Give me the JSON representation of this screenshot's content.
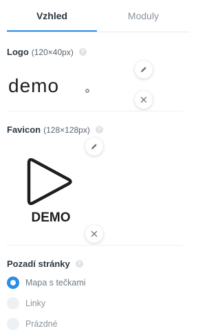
{
  "tabs": [
    {
      "label": "Vzhled",
      "active": true
    },
    {
      "label": "Moduly",
      "active": false
    }
  ],
  "logo": {
    "title": "Logo",
    "size": "(120×40px)",
    "help": "?",
    "image_text": "demo"
  },
  "favicon": {
    "title": "Favicon",
    "size": "(128×128px)",
    "help": "?",
    "image_text": "DEMO"
  },
  "background": {
    "title": "Pozadí stránky",
    "help": "?",
    "options": [
      {
        "label": "Mapa s tečkami",
        "selected": true
      },
      {
        "label": "Linky",
        "selected": false
      },
      {
        "label": "Prázdné",
        "selected": false
      }
    ]
  },
  "colors": {
    "accent": "#2b8de6",
    "text": "#2b3640",
    "muted": "#8a939c"
  },
  "icons": [
    "pencil-icon",
    "remove-icon",
    "help-icon",
    "play-triangle-icon"
  ]
}
